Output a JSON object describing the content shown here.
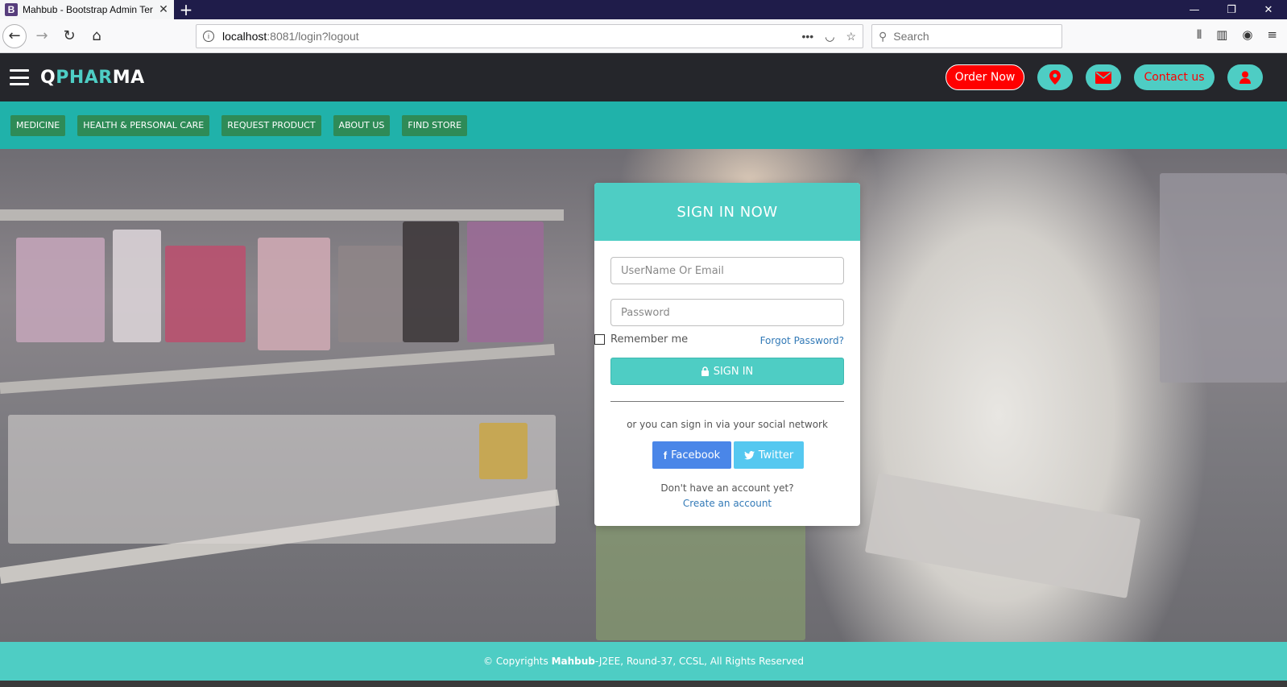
{
  "browser": {
    "tab_title": "Mahbub - Bootstrap Admin Ter",
    "favicon_letter": "B",
    "url_host": "localhost",
    "url_path": ":8081/login?logout",
    "search_placeholder": "Search"
  },
  "header": {
    "logo_q": "Q",
    "logo_phar": "PHAR",
    "logo_ma": "MA",
    "order_now": "Order Now",
    "contact_us": "Contact us"
  },
  "nav": {
    "items": [
      "MEDICINE",
      "HEALTH & PERSONAL CARE",
      "REQUEST PRODUCT",
      "ABOUT US",
      "FIND STORE"
    ]
  },
  "login": {
    "title": "SIGN IN NOW",
    "username_placeholder": "UserName Or Email",
    "password_placeholder": "Password",
    "remember_label": "Remember me",
    "forgot_label": "Forgot Password?",
    "signin_label": "SIGN IN",
    "social_text": "or you can sign in via your social network",
    "facebook_label": "Facebook",
    "twitter_label": "Twitter",
    "no_account_text": "Don't have an account yet?",
    "create_account_label": "Create an account"
  },
  "footer": {
    "prefix": "© Copyrights ",
    "author": "Mahbub",
    "suffix": "-J2EE, Round-37, CCSL, All Rights Reserved"
  },
  "colors": {
    "accent": "#4ecdc4",
    "nav_bg": "#20b2aa",
    "nav_item": "#2e8b57",
    "order_btn": "#ff0000",
    "header_bg": "#25262b"
  }
}
